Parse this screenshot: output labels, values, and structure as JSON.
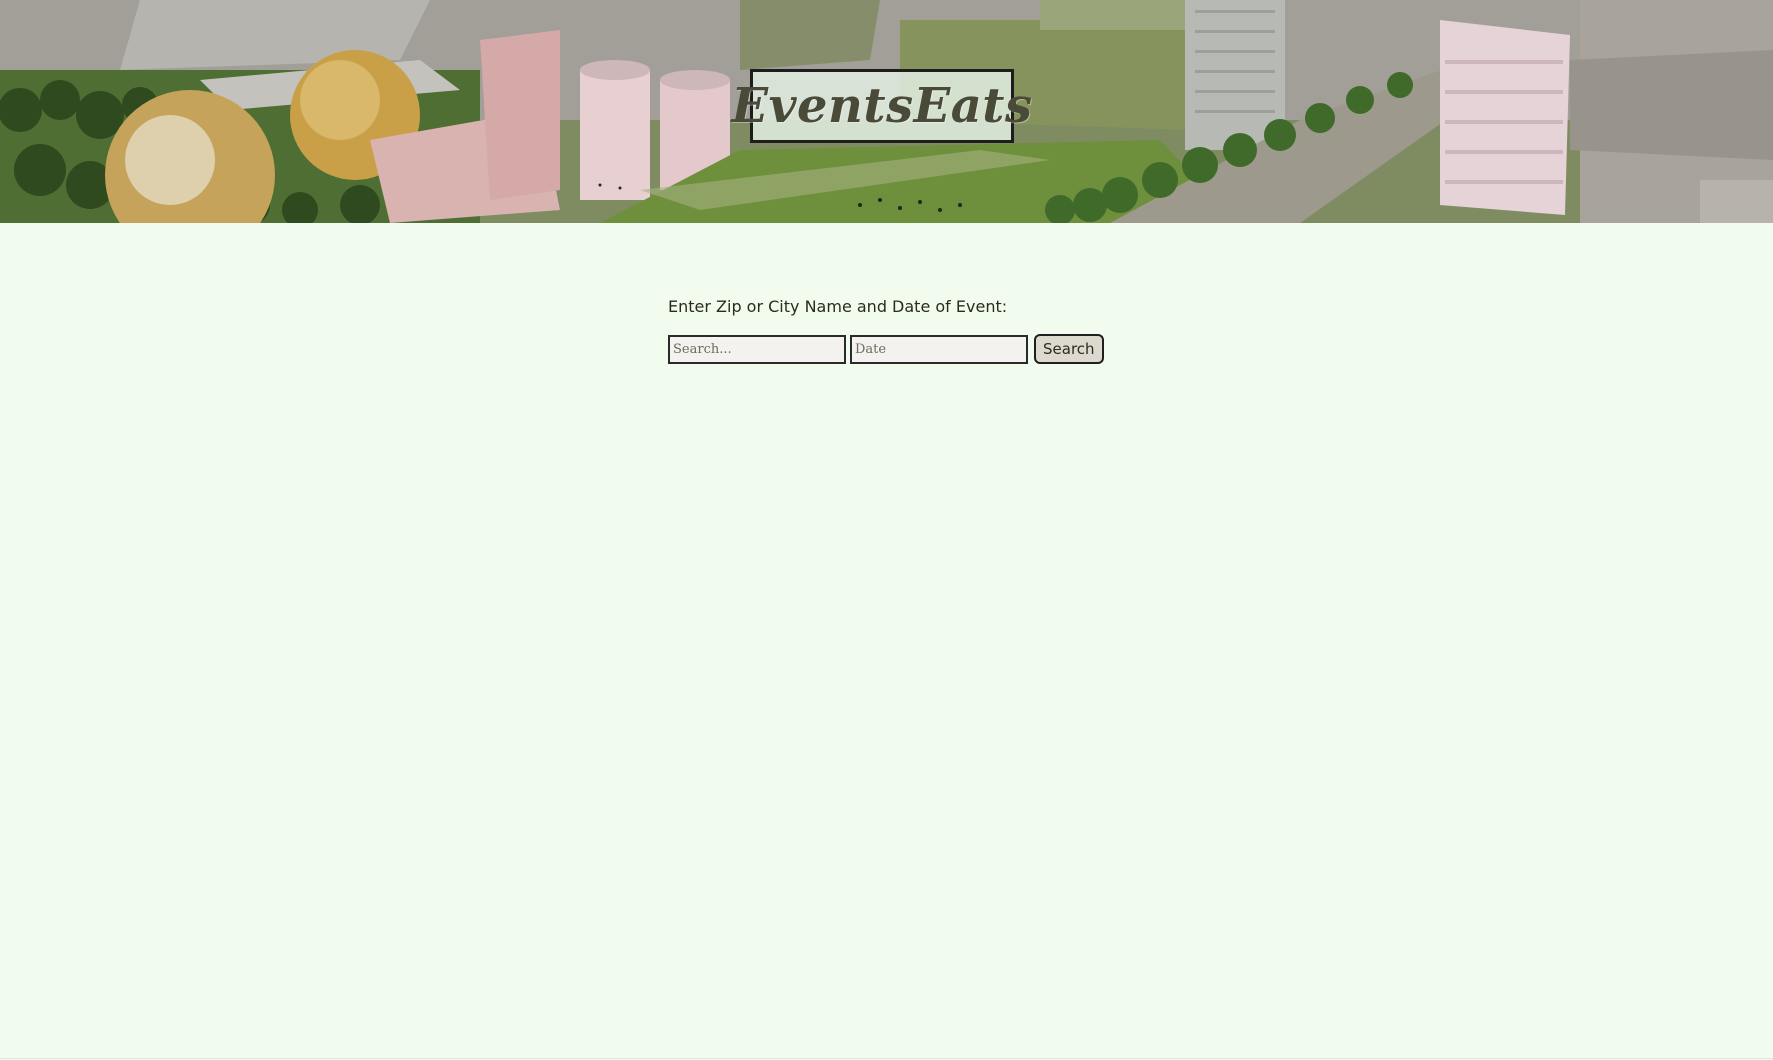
{
  "header": {
    "logo_text": "EventsEats"
  },
  "search": {
    "prompt": "Enter Zip or City Name and Date of Event:",
    "location_placeholder": "Search...",
    "location_value": "",
    "date_placeholder": "Date",
    "date_value": "",
    "button_label": "Search"
  },
  "colors": {
    "page_background": "#f1fcef",
    "logo_text": "#4a4a38"
  }
}
